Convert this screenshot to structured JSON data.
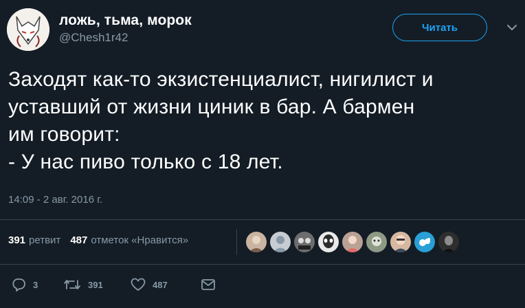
{
  "author": {
    "display_name": "ложь, тьма, морок",
    "handle": "@Chesh1r42",
    "avatar_icon": "white-fox-avatar-icon"
  },
  "follow_button": {
    "label": "Читать"
  },
  "more_menu": {
    "icon": "chevron-down-icon"
  },
  "tweet": {
    "lines": [
      "Заходят как-то экзистенциалист, нигилист и",
      "уставший от жизни циник в бар. А бармен",
      "им говорит:",
      "- У нас пиво только с 18 лет."
    ],
    "timestamp": "14:09 - 2 авг. 2016 г."
  },
  "stats": {
    "retweets_count": "391",
    "retweets_label": "ретвит",
    "likes_count": "487",
    "likes_label": "отметок «Нравится»"
  },
  "likers": [
    {
      "icon": "liker-avatar-1",
      "color": "#c9b3a1"
    },
    {
      "icon": "liker-avatar-2",
      "color": "#c7ccd2"
    },
    {
      "icon": "liker-avatar-3",
      "color": "#6d6d6d"
    },
    {
      "icon": "liker-avatar-4",
      "color": "#e9e9e9"
    },
    {
      "icon": "liker-avatar-5",
      "color": "#b9a295"
    },
    {
      "icon": "liker-avatar-6",
      "color": "#8f9a86"
    },
    {
      "icon": "liker-avatar-7",
      "color": "#d6b8a2"
    },
    {
      "icon": "liker-avatar-8",
      "color": "#2a9fd6"
    },
    {
      "icon": "liker-avatar-9",
      "color": "#2e2e2e"
    }
  ],
  "actions": {
    "reply_count": "3",
    "retweet_count": "391",
    "like_count": "487"
  },
  "colors": {
    "background": "#141d26",
    "accent": "#1da1f2",
    "muted": "#8899a6",
    "divider": "#38444d"
  }
}
